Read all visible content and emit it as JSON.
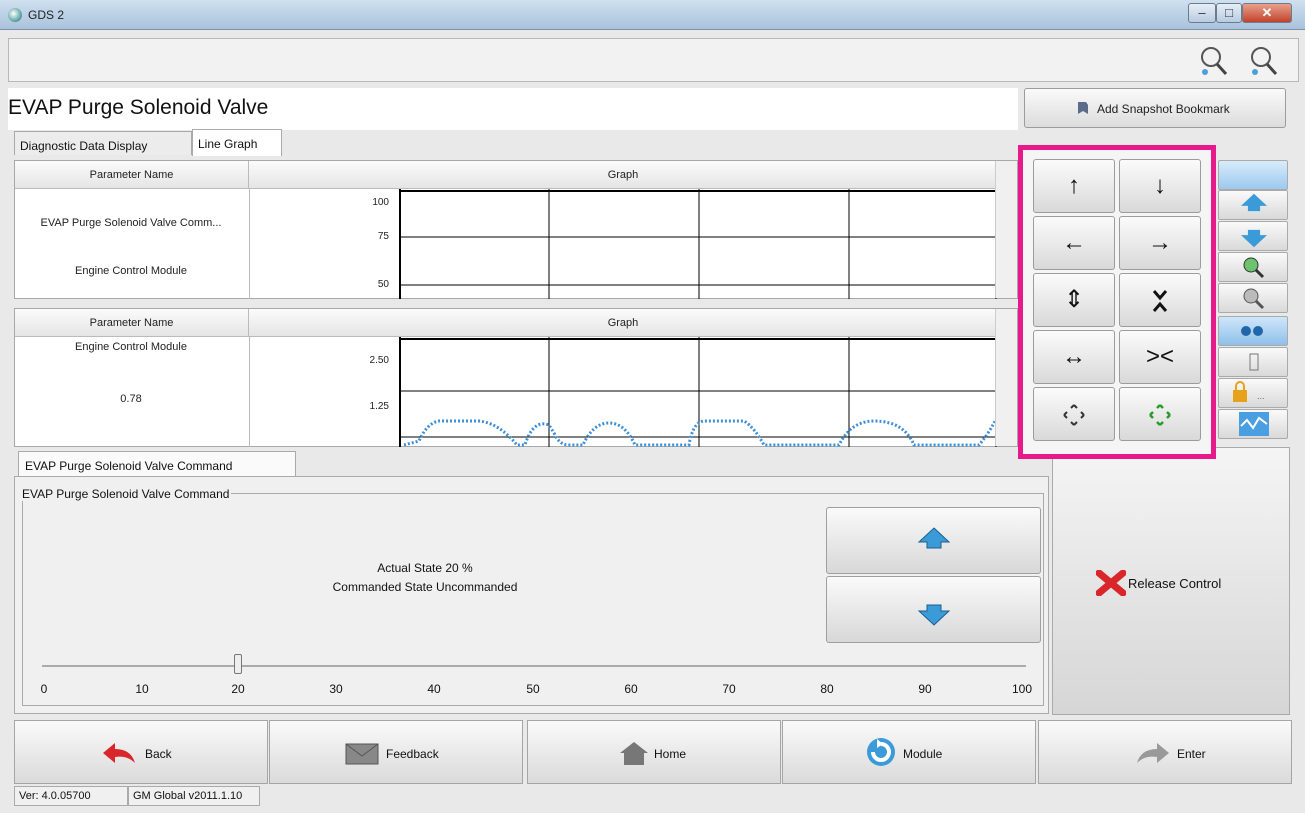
{
  "window": {
    "title": "GDS 2"
  },
  "page": {
    "title": "EVAP Purge Solenoid Valve",
    "snapshot_label": "Add Snapshot Bookmark"
  },
  "tabs": [
    {
      "label": "Diagnostic Data Display"
    },
    {
      "label": "Line Graph"
    }
  ],
  "graph1": {
    "param_header": "Parameter Name",
    "graph_header": "Graph",
    "param_name": "EVAP Purge Solenoid Valve Comm...",
    "module": "Engine Control Module",
    "y_ticks": [
      "100",
      "75",
      "50"
    ]
  },
  "graph2": {
    "param_header": "Parameter Name",
    "graph_header": "Graph",
    "module": "Engine Control Module",
    "value": "0.78",
    "y_ticks": [
      "2.50",
      "1.25"
    ]
  },
  "control": {
    "tab_label": "EVAP Purge Solenoid Valve Command",
    "group_title": "EVAP Purge Solenoid Valve Command",
    "actual_state": "Actual State 20 %",
    "commanded_state": "Commanded State  Uncommanded",
    "slider_value": 20,
    "slider_ticks": [
      "0",
      "10",
      "20",
      "30",
      "40",
      "50",
      "60",
      "70",
      "80",
      "90",
      "100"
    ],
    "release_label": "Release Control"
  },
  "nav_buttons": {
    "up": "↑",
    "down": "↓",
    "left": "←",
    "right": "→",
    "expand_v": "⇕",
    "shrink_v": "x",
    "expand_h": "↔",
    "shrink_h": "><"
  },
  "bottom": {
    "back": "Back",
    "feedback": "Feedback",
    "home": "Home",
    "module": "Module",
    "enter": "Enter"
  },
  "status": {
    "version": "Ver: 4.0.05700",
    "global": "GM Global v2011.1.10"
  },
  "colors": {
    "highlight": "#e8198b",
    "signal": "#3f8fd6",
    "arrow_blue": "#3b9bd9",
    "red": "#d8262b"
  }
}
